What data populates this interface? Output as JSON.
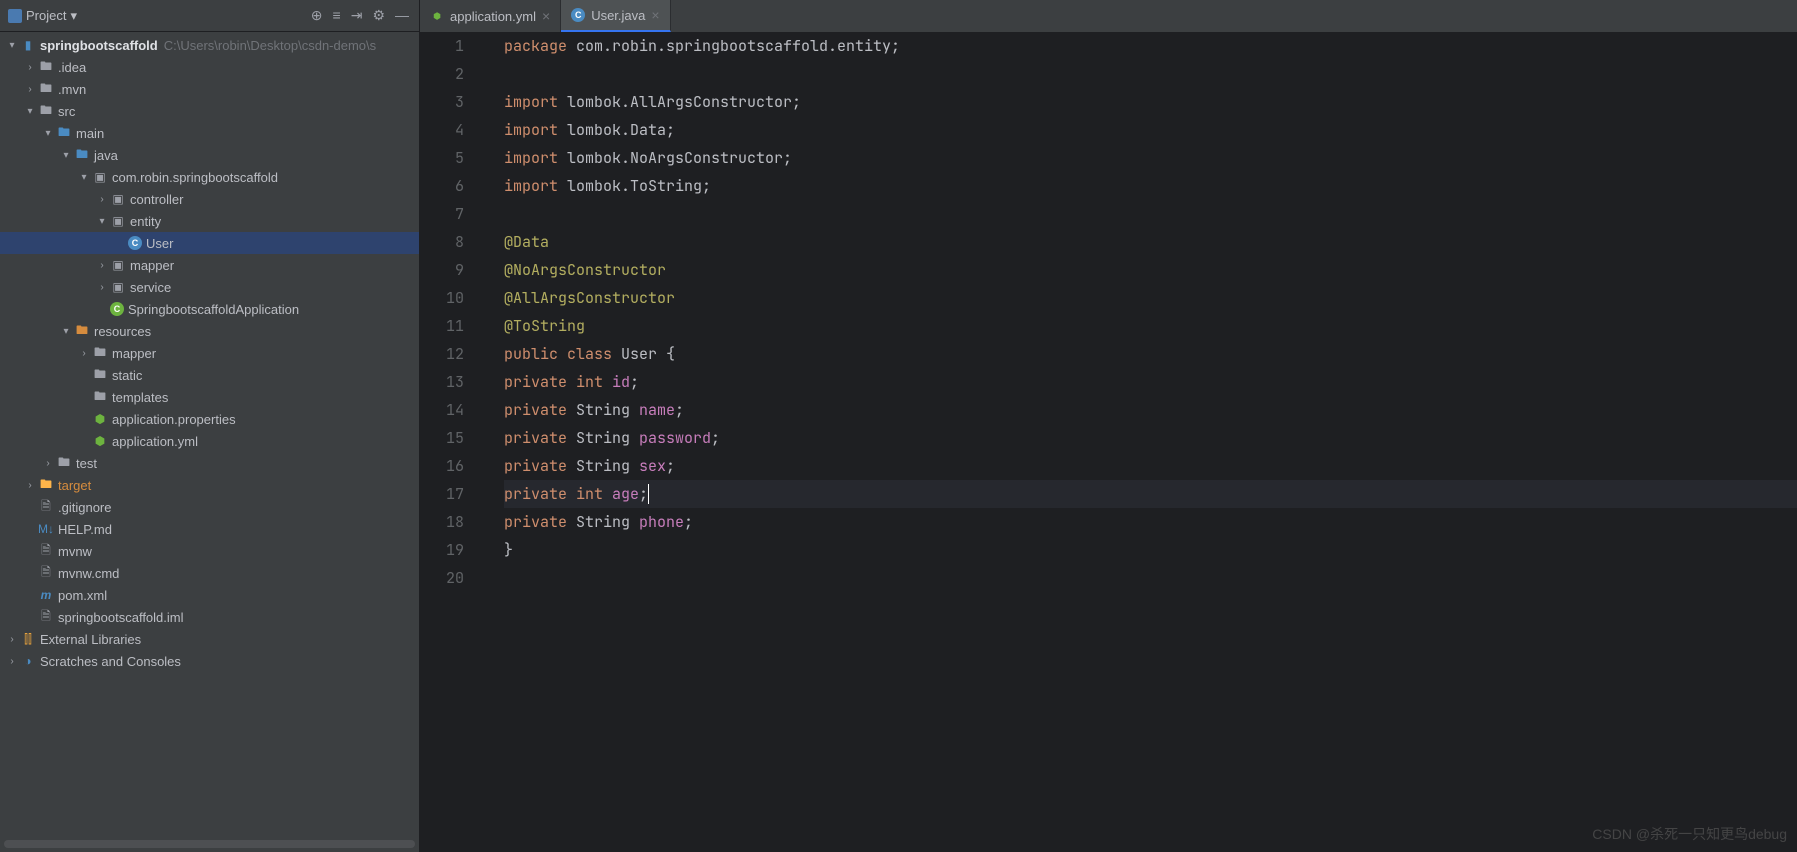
{
  "toolbar": {
    "project_label": "Project"
  },
  "tree": {
    "root": {
      "name": "springbootscaffold",
      "path": "C:\\Users\\robin\\Desktop\\csdn-demo\\s"
    },
    "items": [
      {
        "label": ".idea",
        "depth": 1,
        "arrow": ">",
        "icon": "folder"
      },
      {
        "label": ".mvn",
        "depth": 1,
        "arrow": ">",
        "icon": "folder"
      },
      {
        "label": "src",
        "depth": 1,
        "arrow": "v",
        "icon": "folder"
      },
      {
        "label": "main",
        "depth": 2,
        "arrow": "v",
        "icon": "folder-blue"
      },
      {
        "label": "java",
        "depth": 3,
        "arrow": "v",
        "icon": "folder-blue"
      },
      {
        "label": "com.robin.springbootscaffold",
        "depth": 4,
        "arrow": "v",
        "icon": "pkg"
      },
      {
        "label": "controller",
        "depth": 5,
        "arrow": ">",
        "icon": "pkg"
      },
      {
        "label": "entity",
        "depth": 5,
        "arrow": "v",
        "icon": "pkg"
      },
      {
        "label": "User",
        "depth": 6,
        "arrow": "",
        "icon": "class",
        "selected": true
      },
      {
        "label": "mapper",
        "depth": 5,
        "arrow": ">",
        "icon": "pkg"
      },
      {
        "label": "service",
        "depth": 5,
        "arrow": ">",
        "icon": "pkg"
      },
      {
        "label": "SpringbootscaffoldApplication",
        "depth": 5,
        "arrow": "",
        "icon": "spring-class"
      },
      {
        "label": "resources",
        "depth": 3,
        "arrow": "v",
        "icon": "res-folder"
      },
      {
        "label": "mapper",
        "depth": 4,
        "arrow": ">",
        "icon": "folder"
      },
      {
        "label": "static",
        "depth": 4,
        "arrow": "",
        "icon": "folder"
      },
      {
        "label": "templates",
        "depth": 4,
        "arrow": "",
        "icon": "folder"
      },
      {
        "label": "application.properties",
        "depth": 4,
        "arrow": "",
        "icon": "spring-file"
      },
      {
        "label": "application.yml",
        "depth": 4,
        "arrow": "",
        "icon": "spring-file"
      },
      {
        "label": "test",
        "depth": 2,
        "arrow": ">",
        "icon": "folder"
      },
      {
        "label": "target",
        "depth": 1,
        "arrow": ">",
        "icon": "folder",
        "orange": true
      },
      {
        "label": ".gitignore",
        "depth": 1,
        "arrow": "",
        "icon": "file"
      },
      {
        "label": "HELP.md",
        "depth": 1,
        "arrow": "",
        "icon": "md"
      },
      {
        "label": "mvnw",
        "depth": 1,
        "arrow": "",
        "icon": "file"
      },
      {
        "label": "mvnw.cmd",
        "depth": 1,
        "arrow": "",
        "icon": "file"
      },
      {
        "label": "pom.xml",
        "depth": 1,
        "arrow": "",
        "icon": "maven"
      },
      {
        "label": "springbootscaffold.iml",
        "depth": 1,
        "arrow": "",
        "icon": "file"
      }
    ],
    "ext_libs": "External Libraries",
    "scratches": "Scratches and Consoles"
  },
  "tabs": [
    {
      "label": "application.yml",
      "icon": "spring",
      "active": false
    },
    {
      "label": "User.java",
      "icon": "class",
      "active": true
    }
  ],
  "code": {
    "lines": [
      {
        "n": 1,
        "tokens": [
          [
            "kw",
            "package "
          ],
          [
            "pkg-path",
            "com.robin.springbootscaffold.entity"
          ],
          [
            "punct",
            ";"
          ]
        ]
      },
      {
        "n": 2,
        "tokens": []
      },
      {
        "n": 3,
        "tokens": [
          [
            "kw",
            "import "
          ],
          [
            "pkg-path",
            "lombok.AllArgsConstructor"
          ],
          [
            "punct",
            ";"
          ]
        ]
      },
      {
        "n": 4,
        "tokens": [
          [
            "kw",
            "import "
          ],
          [
            "pkg-path",
            "lombok.Data"
          ],
          [
            "punct",
            ";"
          ]
        ]
      },
      {
        "n": 5,
        "tokens": [
          [
            "kw",
            "import "
          ],
          [
            "pkg-path",
            "lombok.NoArgsConstructor"
          ],
          [
            "punct",
            ";"
          ]
        ]
      },
      {
        "n": 6,
        "tokens": [
          [
            "kw",
            "import "
          ],
          [
            "pkg-path",
            "lombok.ToString"
          ],
          [
            "punct",
            ";"
          ]
        ]
      },
      {
        "n": 7,
        "tokens": []
      },
      {
        "n": 8,
        "tokens": [
          [
            "ann",
            "@Data"
          ]
        ]
      },
      {
        "n": 9,
        "tokens": [
          [
            "ann",
            "@NoArgsConstructor"
          ]
        ]
      },
      {
        "n": 10,
        "tokens": [
          [
            "ann",
            "@AllArgsConstructor"
          ]
        ]
      },
      {
        "n": 11,
        "tokens": [
          [
            "ann",
            "@ToString"
          ]
        ]
      },
      {
        "n": 12,
        "tokens": [
          [
            "kw",
            "public class "
          ],
          [
            "type",
            "User "
          ],
          [
            "punct",
            "{"
          ]
        ]
      },
      {
        "n": 13,
        "tokens": [
          [
            "indent",
            "    "
          ],
          [
            "kw",
            "private int "
          ],
          [
            "field",
            "id"
          ],
          [
            "punct",
            ";"
          ]
        ]
      },
      {
        "n": 14,
        "tokens": [
          [
            "indent",
            "    "
          ],
          [
            "kw",
            "private "
          ],
          [
            "type",
            "String "
          ],
          [
            "field",
            "name"
          ],
          [
            "punct",
            ";"
          ]
        ]
      },
      {
        "n": 15,
        "tokens": [
          [
            "indent",
            "    "
          ],
          [
            "kw",
            "private "
          ],
          [
            "type",
            "String "
          ],
          [
            "field",
            "password"
          ],
          [
            "punct",
            ";"
          ]
        ]
      },
      {
        "n": 16,
        "tokens": [
          [
            "indent",
            "    "
          ],
          [
            "kw",
            "private "
          ],
          [
            "type",
            "String "
          ],
          [
            "field",
            "sex"
          ],
          [
            "punct",
            ";"
          ]
        ]
      },
      {
        "n": 17,
        "tokens": [
          [
            "indent",
            "    "
          ],
          [
            "kw",
            "private int "
          ],
          [
            "field",
            "age"
          ],
          [
            "punct",
            ";"
          ]
        ],
        "cursor": true
      },
      {
        "n": 18,
        "tokens": [
          [
            "indent",
            "    "
          ],
          [
            "kw",
            "private "
          ],
          [
            "type",
            "String "
          ],
          [
            "field",
            "phone"
          ],
          [
            "punct",
            ";"
          ]
        ]
      },
      {
        "n": 19,
        "tokens": [
          [
            "punct",
            "}"
          ]
        ]
      },
      {
        "n": 20,
        "tokens": []
      }
    ]
  },
  "watermark": "CSDN @杀死一只知更鸟debug"
}
